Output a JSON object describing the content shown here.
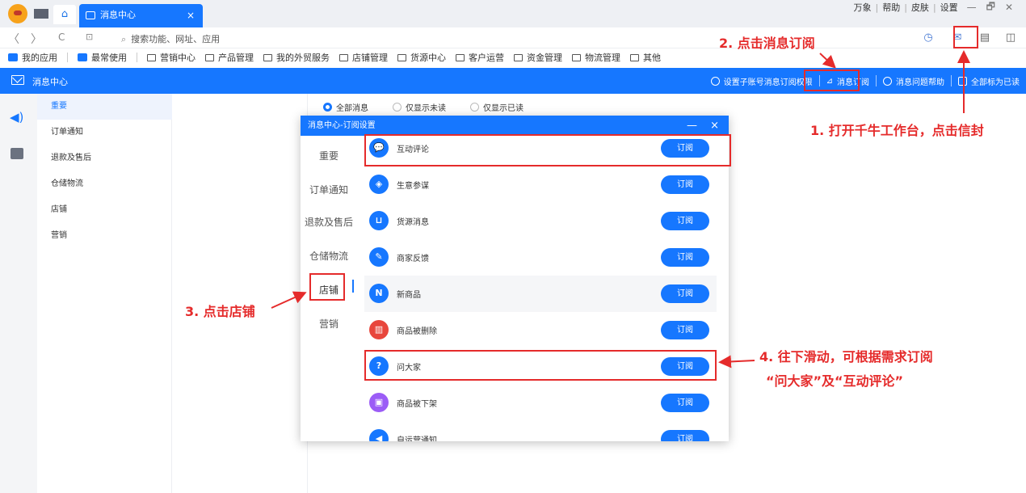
{
  "titlebar": {
    "tab_title": "消息中心",
    "tab_close": "×",
    "top_links": [
      "万象",
      "帮助",
      "皮肤",
      "设置"
    ],
    "win_min": "—",
    "win_restore": "🗗",
    "win_close": "✕"
  },
  "navbar": {
    "back": "〈",
    "forward": "〉",
    "refresh": "C",
    "search_placeholder": "搜索功能、网址、应用"
  },
  "bookmarks": [
    "我的应用",
    "最常使用",
    "营销中心",
    "产品管理",
    "我的外贸服务",
    "店铺管理",
    "货源中心",
    "客户运营",
    "资金管理",
    "物流管理",
    "其他"
  ],
  "header": {
    "title": "消息中心",
    "actions": [
      "设置子账号消息订阅权限",
      "消息订阅",
      "消息问题帮助",
      "全部标为已读"
    ]
  },
  "categories": [
    "重要",
    "订单通知",
    "退款及售后",
    "仓储物流",
    "店铺",
    "营销"
  ],
  "filters": [
    "全部消息",
    "仅显示未读",
    "仅显示已读"
  ],
  "modal": {
    "title": "消息中心-订阅设置",
    "minimize": "—",
    "close": "×",
    "side": [
      "重要",
      "订单通知",
      "退款及售后",
      "仓储物流",
      "店铺",
      "营销"
    ],
    "rows": [
      {
        "label": "互动评论",
        "button": "订阅",
        "icon": "chat-icon",
        "color": "#1677ff"
      },
      {
        "label": "生意参谋",
        "button": "订阅",
        "icon": "compass-icon",
        "color": "#1677ff"
      },
      {
        "label": "货源消息",
        "button": "订阅",
        "icon": "cart-icon",
        "color": "#1677ff"
      },
      {
        "label": "商家反馈",
        "button": "订阅",
        "icon": "feedback-icon",
        "color": "#1677ff"
      },
      {
        "label": "新商品",
        "button": "订阅",
        "icon": "new-product-icon",
        "color": "#1677ff"
      },
      {
        "label": "商品被删除",
        "button": "订阅",
        "icon": "trash-icon",
        "color": "#e8463c"
      },
      {
        "label": "问大家",
        "button": "订阅",
        "icon": "question-icon",
        "color": "#1677ff"
      },
      {
        "label": "商品被下架",
        "button": "订阅",
        "icon": "lock-icon",
        "color": "#9b5cf6"
      },
      {
        "label": "自运营通知",
        "button": "订阅",
        "icon": "megaphone-icon",
        "color": "#1677ff"
      }
    ]
  },
  "annotations": {
    "step1": "1. 打开千牛工作台，点击信封",
    "step2": "2. 点击消息订阅",
    "step3": "3. 点击店铺",
    "step4_line1": "4. 往下滑动，可根据需求订阅",
    "step4_line2": "“问大家”及“互动评论”"
  },
  "colors": {
    "accent": "#1677ff",
    "annotation": "#e52b2b"
  }
}
